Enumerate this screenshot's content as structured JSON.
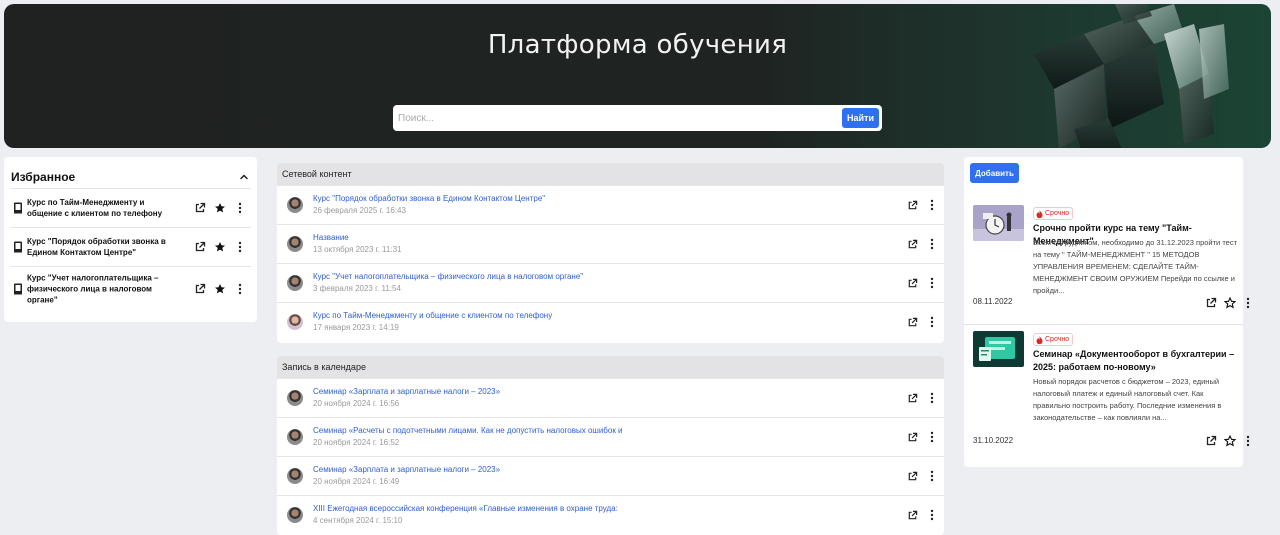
{
  "header": {
    "title": "Платформа обучения",
    "search_placeholder": "Поиск...",
    "search_button": "Найти"
  },
  "favorites": {
    "title": "Избранное",
    "items": [
      {
        "label": "Курс по Тайм-Менеджменту и общение с клиентом по телефону"
      },
      {
        "label": "Курс \"Порядок обработки звонка в Едином Контактом Центре\""
      },
      {
        "label": "Курс \"Учет налогоплательщика – физического лица в налоговом органе\""
      }
    ]
  },
  "network": {
    "title": "Сетевой контент",
    "rows": [
      {
        "title": "Курс \"Порядок обработки звонка в Едином Контактом Центре\"",
        "date": "26 февраля 2025 г. 16:43"
      },
      {
        "title": "Название",
        "date": "13 октября 2023 г. 11:31"
      },
      {
        "title": "Курс \"Учет налогоплательщика – физического лица в налоговом органе\"",
        "date": "3 февраля 2023 г. 11:54"
      },
      {
        "title": "Курс по Тайм-Менеджменту и общение с клиентом по телефону",
        "date": "17 января 2023 г. 14:19"
      }
    ]
  },
  "calendar": {
    "title": "Запись в календаре",
    "rows": [
      {
        "title": "Семинар «Зарплата и зарплатные налоги – 2023»",
        "date": "20 ноября 2024 г. 16:56"
      },
      {
        "title": "Семинар «Расчеты с подотчетными лицами. Как не допустить налоговых ошибок и",
        "date": "20 ноября 2024 г. 16:52"
      },
      {
        "title": "Семинар «Зарплата и зарплатные налоги – 2023»",
        "date": "20 ноября 2024 г. 16:49"
      },
      {
        "title": "XIII Ежегодная всероссийская конференция «Главные изменения в охране труда:",
        "date": "4 сентября 2024 г. 15:10"
      }
    ]
  },
  "news": {
    "add_button": "Добавить",
    "items": [
      {
        "badge": "Срочно",
        "title": "Срочно пройти курс на тему \"Тайм-Менеджмент\"",
        "text": "Всем сотрудником, необходимо до 31.12.2023 пройти тест на тему \" ТАЙМ-МЕНЕДЖМЕНТ \" 15 МЕТОДОВ УПРАВЛЕНИЯ ВРЕМЕНЕМ: СДЕЛАЙТЕ ТАЙМ-МЕНЕДЖМЕНТ СВОИМ ОРУЖИЕМ Перейди по ссылке и пройди...",
        "date": "08.11.2022"
      },
      {
        "badge": "Срочно",
        "title": "Семинар «Документооборот в бухгалтерии – 2025: работаем по-новому»",
        "text": "Новый порядок расчетов с бюджетом – 2023, единый налоговый платеж и единый налоговый счет. Как правильно построить работу. Последние изменения в законодательстве – как повлияли на...",
        "date": "31.10.2022"
      }
    ]
  },
  "colors": {
    "accent": "#2f6ff0",
    "link": "#2f5fd0",
    "urgent": "#dd2222"
  }
}
